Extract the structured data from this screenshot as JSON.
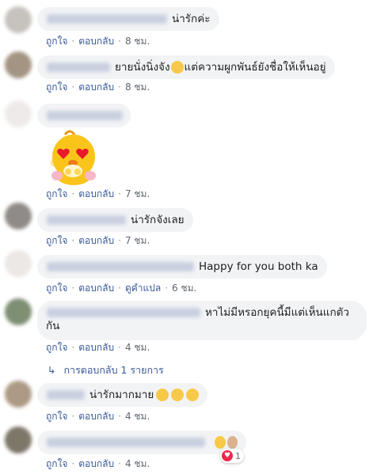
{
  "actions": {
    "like": "ถูกใจ",
    "reply": "ตอบกลับ",
    "translate": "ดูคำแปล"
  },
  "comments": [
    {
      "text": "น่ารักค่ะ",
      "time": "8 ชม."
    },
    {
      "text": "ยายนั่งนิ่งจัง",
      "text2": "แต่ความผูกพันธ์ยังชื่อให้เห็นอยู่",
      "time": "8 ชม."
    },
    {
      "text": "",
      "time": "7 ชม.",
      "sticker": "heart-eyes-chick-sticker"
    },
    {
      "text": "น่ารักจังเลย",
      "time": "7 ชม."
    },
    {
      "text": "Happy for you both ka",
      "time": "6 ชม."
    },
    {
      "text": "หาไม่มีหรอกยุคนี้มีแต่เห็นแกตัว",
      "text2": "กัน",
      "time": "4 ชม."
    },
    {
      "text": "น่ารักมากมาย",
      "time": "4 ชม."
    },
    {
      "text": "",
      "time": "4 ชม."
    }
  ],
  "replies_link": "การตอบกลับ 1 รายการ",
  "reaction": {
    "icon": "heart-reaction-icon",
    "count": "1"
  },
  "colors": {
    "link": "#385898",
    "bubble": "#f2f3f5"
  }
}
